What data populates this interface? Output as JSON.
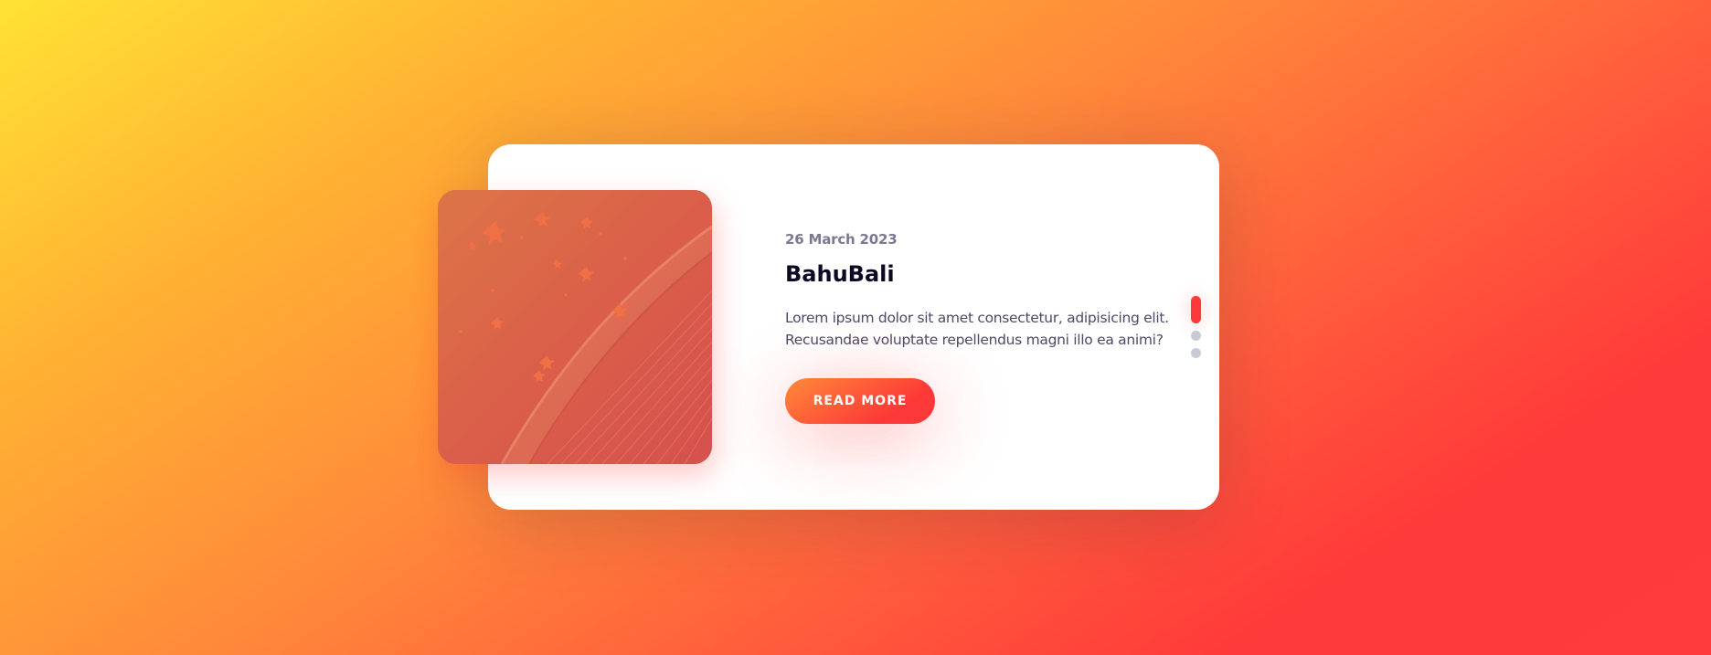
{
  "post": {
    "date": "26 March 2023",
    "title": "BahuBali",
    "text_line1": "Lorem ipsum dolor sit amet consectetur, adipisicing elit.",
    "text_line2": "Recusandae voluptate repellendus magni illo ea animi?",
    "button_label": "READ MORE"
  },
  "slider": {
    "active_index": 0,
    "slide_count": 3
  },
  "colors": {
    "accent": "#fd3838",
    "accent_start": "#fe8a39",
    "title": "#0d0925",
    "date": "#7b7992",
    "body_text": "#4e4a67",
    "inactive_bullet": "#c7cbd6"
  },
  "image": {
    "subject": "aerial view of autumn leaves on red-tinted ground with a curved curb"
  }
}
